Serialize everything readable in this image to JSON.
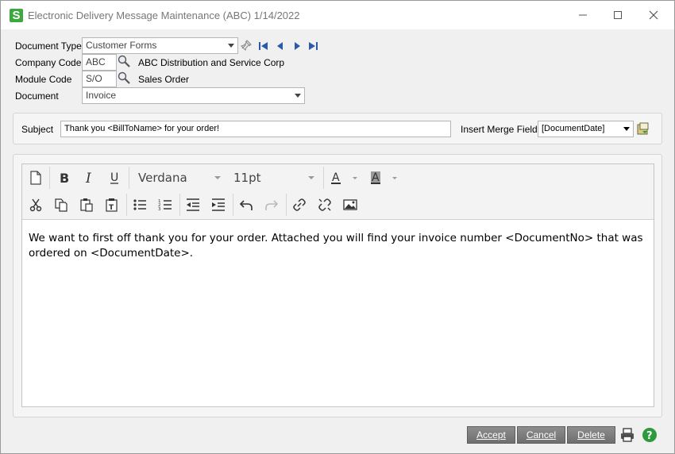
{
  "window": {
    "title": "Electronic Delivery Message Maintenance (ABC) 1/14/2022",
    "app_icon_letter": "S"
  },
  "form": {
    "document_type_label": "Document Type",
    "document_type_value": "Customer Forms",
    "company_code_label": "Company Code",
    "company_code_value": "ABC",
    "company_name": "ABC Distribution and Service Corp",
    "module_code_label": "Module Code",
    "module_code_value": "S/O",
    "module_name": "Sales Order",
    "document_label": "Document",
    "document_value": "Invoice"
  },
  "subject": {
    "label": "Subject",
    "value": "Thank you <BillToName> for your order!",
    "merge_field_label": "Insert Merge Field",
    "merge_field_value": "[DocumentDate]"
  },
  "editor": {
    "font_name": "Verdana",
    "font_size": "11pt",
    "body_text": "We want to first off thank you for your order.  Attached you will find your invoice number <DocumentNo> that was ordered on <DocumentDate>."
  },
  "footer": {
    "accept_label": "Accept",
    "cancel_label": "Cancel",
    "delete_label": "Delete"
  },
  "colors": {
    "app_green": "#3da83d",
    "nav_blue": "#2a5aa8",
    "button_gray": "#7a7a7a",
    "help_green": "#2e9a3e"
  }
}
